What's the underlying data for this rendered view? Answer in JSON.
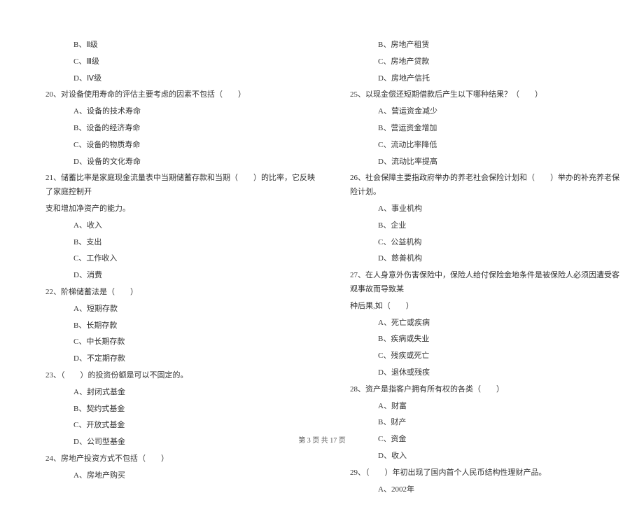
{
  "left": {
    "pre_opts": [
      "B、Ⅱ级",
      "C、Ⅲ级",
      "D、Ⅳ级"
    ],
    "q20": "20、对设备使用寿命的评估主要考虑的因素不包括（　　）",
    "q20_opts": [
      "A、设备的技术寿命",
      "B、设备的经济寿命",
      "C、设备的物质寿命",
      "D、设备的文化寿命"
    ],
    "q21": "21、储蓄比率是家庭现金流量表中当期储蓄存款和当期（　　）的比率，它反映了家庭控制开",
    "q21_cont": "支和增加净资产的能力。",
    "q21_opts": [
      "A、收入",
      "B、支出",
      "C、工作收入",
      "D、消费"
    ],
    "q22": "22、阶梯储蓄法是（　　）",
    "q22_opts": [
      "A、短期存款",
      "B、长期存款",
      "C、中长期存款",
      "D、不定期存款"
    ],
    "q23": "23、（　　）的投资份额是可以不固定的。",
    "q23_opts": [
      "A、封闭式基金",
      "B、契约式基金",
      "C、开放式基金",
      "D、公司型基金"
    ],
    "q24": "24、房地产投资方式不包括（　　）",
    "q24_opts": [
      "A、房地产购买"
    ]
  },
  "right": {
    "pre_opts": [
      "B、房地产租赁",
      "C、房地产贷款",
      "D、房地产信托"
    ],
    "q25": "25、以现金偿还短期借款后产生以下哪种结果？（　　）",
    "q25_opts": [
      "A、营运资金减少",
      "B、营运资金增加",
      "C、流动比率降低",
      "D、流动比率提高"
    ],
    "q26": "26、社会保障主要指政府举办的养老社会保险计划和（　　）举办的补充养老保险计划。",
    "q26_opts": [
      "A、事业机构",
      "B、企业",
      "C、公益机构",
      "D、慈善机构"
    ],
    "q27": "27、在人身意外伤害保险中，保险人给付保险金地条件是被保险人必须因遭受客观事故而导致某",
    "q27_cont": "种后果,如（　　）",
    "q27_opts": [
      "A、死亡或疾病",
      "B、疾病或失业",
      "C、残疾或死亡",
      "D、退休或残疾"
    ],
    "q28": "28、资产是指客户拥有所有权的各类（　　）",
    "q28_opts": [
      "A、财富",
      "B、财产",
      "C、资金",
      "D、收入"
    ],
    "q29": "29、（　　）年初出现了国内首个人民币结构性理财产品。",
    "q29_opts": [
      "A、2002年"
    ]
  },
  "footer": "第 3 页 共 17 页"
}
